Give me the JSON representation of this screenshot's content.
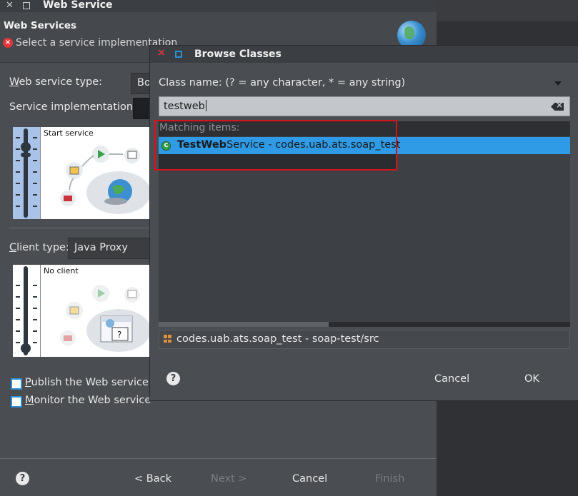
{
  "wizard": {
    "window_title": "Web Service",
    "header_title": "Web Services",
    "error_message": "Select a service implementation",
    "service_type_label_u": "W",
    "service_type_label_rest": "eb service type:",
    "service_type_value": "Bo",
    "service_impl_label": "Service implementation:",
    "server_slider_caption": "Start service",
    "client_type_label_u": "C",
    "client_type_label_rest": "lient type:",
    "client_type_value": "Java Proxy",
    "client_slider_caption": "No client",
    "publish_u": "P",
    "publish_rest": "ublish the Web service",
    "monitor_u": "M",
    "monitor_rest": "onitor the Web service",
    "help_glyph": "?",
    "back_label": "< Back",
    "next_label": "Next >",
    "cancel_label": "Cancel",
    "finish_label": "Finish"
  },
  "dialog": {
    "title": "Browse Classes",
    "class_name_label": "Class name: (? = any character, * = any string)",
    "search_value": "testweb",
    "matching_header": "Matching items:",
    "result_bold": "TestWeb",
    "result_rest": "Service - codes.uab.ats.soap_test",
    "status_text": "codes.uab.ats.soap_test - soap-test/src",
    "help_glyph": "?",
    "cancel_label": "Cancel",
    "ok_label": "OK"
  },
  "icons": [
    "close-icon",
    "maximize-icon",
    "error-icon",
    "globe-icon",
    "dropdown-caret-icon",
    "clear-icon",
    "class-icon",
    "package-icon",
    "help-icon"
  ],
  "colors": {
    "selection": "#2f9ae6",
    "highlight_box": "#d6121b",
    "checkbox_border": "#2d8fd6",
    "error": "#e2363c"
  }
}
